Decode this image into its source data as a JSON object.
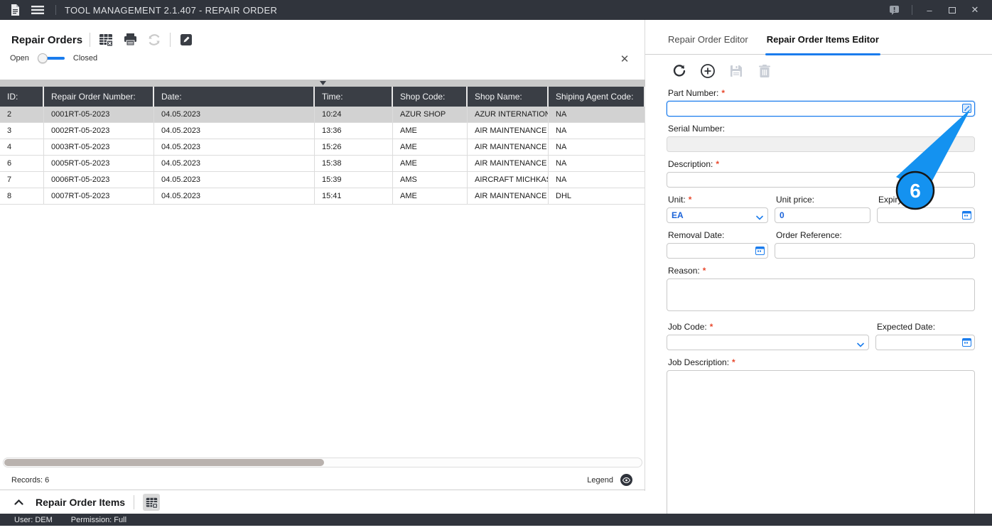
{
  "titlebar": {
    "title": "TOOL MANAGEMENT 2.1.407 - REPAIR ORDER",
    "minimize_glyph": "–",
    "close_glyph": "✕"
  },
  "left_panel": {
    "title": "Repair Orders",
    "close_glyph": "✕",
    "toggle": {
      "left_label": "Open",
      "right_label": "Closed",
      "state": "open"
    },
    "table": {
      "columns": [
        "ID:",
        "Repair Order Number:",
        "Date:",
        "Time:",
        "Shop Code:",
        "Shop Name:",
        "Shiping Agent Code:"
      ],
      "rows": [
        [
          "2",
          "0001RT-05-2023",
          "04.05.2023",
          "10:24",
          "AZUR SHOP",
          "AZUR INTERNATION...",
          "NA"
        ],
        [
          "3",
          "0002RT-05-2023",
          "04.05.2023",
          "13:36",
          "AME",
          "AIR MAINTENANCE E...",
          "NA"
        ],
        [
          "4",
          "0003RT-05-2023",
          "04.05.2023",
          "15:26",
          "AME",
          "AIR MAINTENANCE E...",
          "NA"
        ],
        [
          "6",
          "0005RT-05-2023",
          "04.05.2023",
          "15:38",
          "AME",
          "AIR MAINTENANCE E...",
          "NA"
        ],
        [
          "7",
          "0006RT-05-2023",
          "04.05.2023",
          "15:39",
          "AMS",
          "AIRCRAFT MICHKAS...",
          "NA"
        ],
        [
          "8",
          "0007RT-05-2023",
          "04.05.2023",
          "15:41",
          "AME",
          "AIR MAINTENANCE E...",
          "DHL"
        ]
      ],
      "selected_row_index": 0
    },
    "records_label": "Records: 6",
    "legend_label": "Legend"
  },
  "items_bar": {
    "title": "Repair Order Items"
  },
  "status_bar": {
    "user": "User: DEM",
    "permission": "Permission: Full"
  },
  "editor": {
    "tabs": [
      {
        "label": "Repair Order Editor",
        "active": false
      },
      {
        "label": "Repair Order Items Editor",
        "active": true
      }
    ],
    "fields": {
      "part_number": {
        "label": "Part Number:",
        "required": true,
        "value": ""
      },
      "serial_number": {
        "label": "Serial Number:",
        "required": false,
        "value": ""
      },
      "description": {
        "label": "Description:",
        "required": true,
        "value": ""
      },
      "unit": {
        "label": "Unit:",
        "required": true,
        "value": "EA"
      },
      "unit_price": {
        "label": "Unit price:",
        "required": false,
        "value": "0"
      },
      "expiry_date": {
        "label": "Expiry Date:",
        "required": false,
        "value": ""
      },
      "removal_date": {
        "label": "Removal Date:",
        "required": false,
        "value": ""
      },
      "order_reference": {
        "label": "Order Reference:",
        "required": false,
        "value": ""
      },
      "reason": {
        "label": "Reason:",
        "required": true,
        "value": ""
      },
      "job_code": {
        "label": "Job Code:",
        "required": true,
        "value": ""
      },
      "expected_date": {
        "label": "Expected Date:",
        "required": false,
        "value": ""
      },
      "job_description": {
        "label": "Job Description:",
        "required": true,
        "value": ""
      }
    },
    "callout": {
      "number": "6"
    }
  },
  "ui": {
    "required_marker": "*"
  },
  "colors": {
    "accent_blue": "#1a7ced",
    "callout_blue": "#1492f0",
    "titlebar_bg": "#30343c",
    "table_header_bg": "#3a3e45",
    "selected_row_bg": "#d2d2d2",
    "required_red": "#e8492e",
    "blue_text": "#1a62d8"
  }
}
